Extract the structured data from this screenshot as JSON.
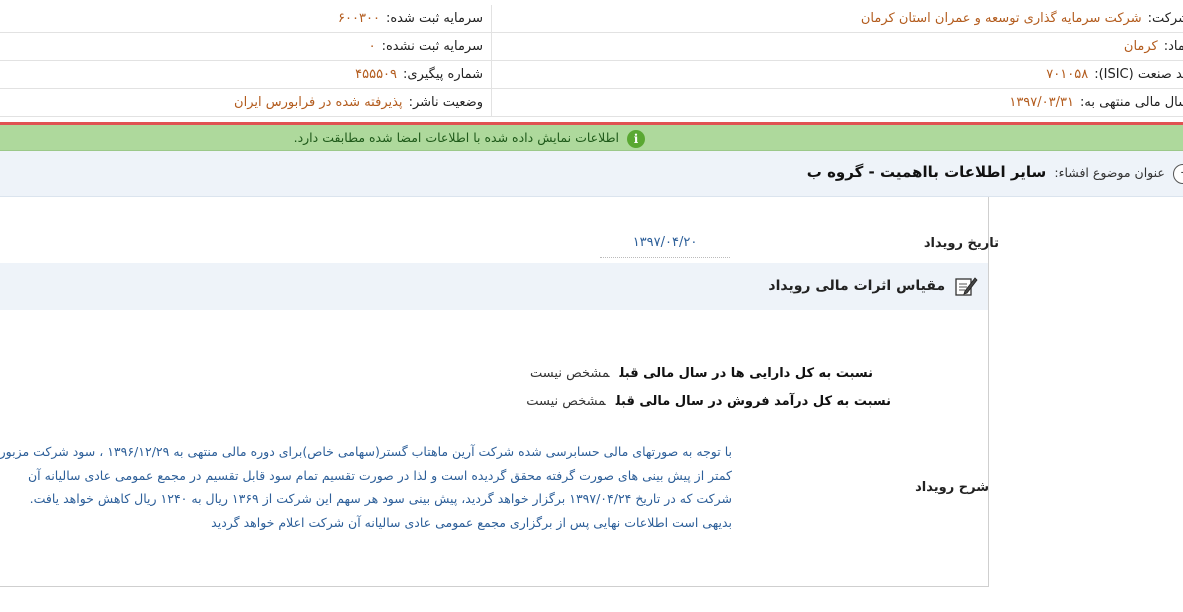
{
  "header": {
    "rows": [
      {
        "right_label": "شرکت:",
        "right_value": "شرکت سرمایه گذاری توسعه و عمران استان کرمان",
        "left_label": "سرمایه ثبت شده:",
        "left_value": "۶۰۰۳۰۰"
      },
      {
        "right_label": "نماد:",
        "right_value": "کرمان",
        "left_label": "سرمایه ثبت نشده:",
        "left_value": "۰"
      },
      {
        "right_label": "کد صنعت (ISIC):",
        "right_value": "۷۰۱۰۵۸",
        "left_label": "شماره پیگیری:",
        "left_value": "۴۵۵۵۰۹"
      },
      {
        "right_label": "سال مالی منتهی به:",
        "right_value": "۱۳۹۷/۰۳/۳۱",
        "left_label": "وضعیت ناشر:",
        "left_value": "پذیرفته شده در فرابورس ایران"
      }
    ]
  },
  "notice": {
    "text": "اطلاعات نمایش داده شده با اطلاعات امضا شده مطابقت دارد.",
    "icon": "info-icon",
    "icon_glyph": "i"
  },
  "title": {
    "label": "عنوان موضوع افشاء:",
    "value": "سایر اطلاعات بااهمیت - گروه ب",
    "collapse_glyph": "-"
  },
  "event_date": {
    "label": "تاریخ رویداد",
    "value": "۱۳۹۷/۰۴/۲۰"
  },
  "section": {
    "title": "مقیاس اثرات مالی رویداد",
    "icon": "edit-document-icon"
  },
  "ratios": [
    {
      "label": "نسبت به کل دارایی ها در سال مالی قبل",
      "value": "مشخص نیست"
    },
    {
      "label": "نسبت به کل درآمد فروش در سال مالی قبل",
      "value": "مشخص نیست"
    }
  ],
  "description": {
    "label": "شرح رویداد",
    "lines": [
      "با توجه به صورتهای مالی حسابرسی شده شرکت آرین ماهتاب گستر(سهامی خاص)برای دوره مالی منتهی به ۱۳۹۶/۱۲/۲۹ ، سود شرکت مزبور",
      "کمتر از پیش بینی های صورت گرفته محقق گردیده است و لذا در صورت تقسیم تمام سود قابل تقسیم در مجمع عمومی عادی سالیانه آن",
      "شرکت که در تاریخ ۱۳۹۷/۰۴/۲۴ برگزار خواهد گردید، پیش بینی سود هر سهم این شرکت از ۱۳۶۹ ریال به ۱۲۴۰ ریال کاهش خواهد یافت.",
      "بدیهی است اطلاعات نهایی پس از برگزاری مجمع عمومی عادی سالیانه آن شرکت اعلام خواهد گردید"
    ]
  },
  "colors": {
    "value_orange": "#b35c1e",
    "value_blue": "#2d5f99",
    "notice_green": "#aed99c",
    "alert_red": "#e05252",
    "section_bg": "#eef3f9"
  }
}
